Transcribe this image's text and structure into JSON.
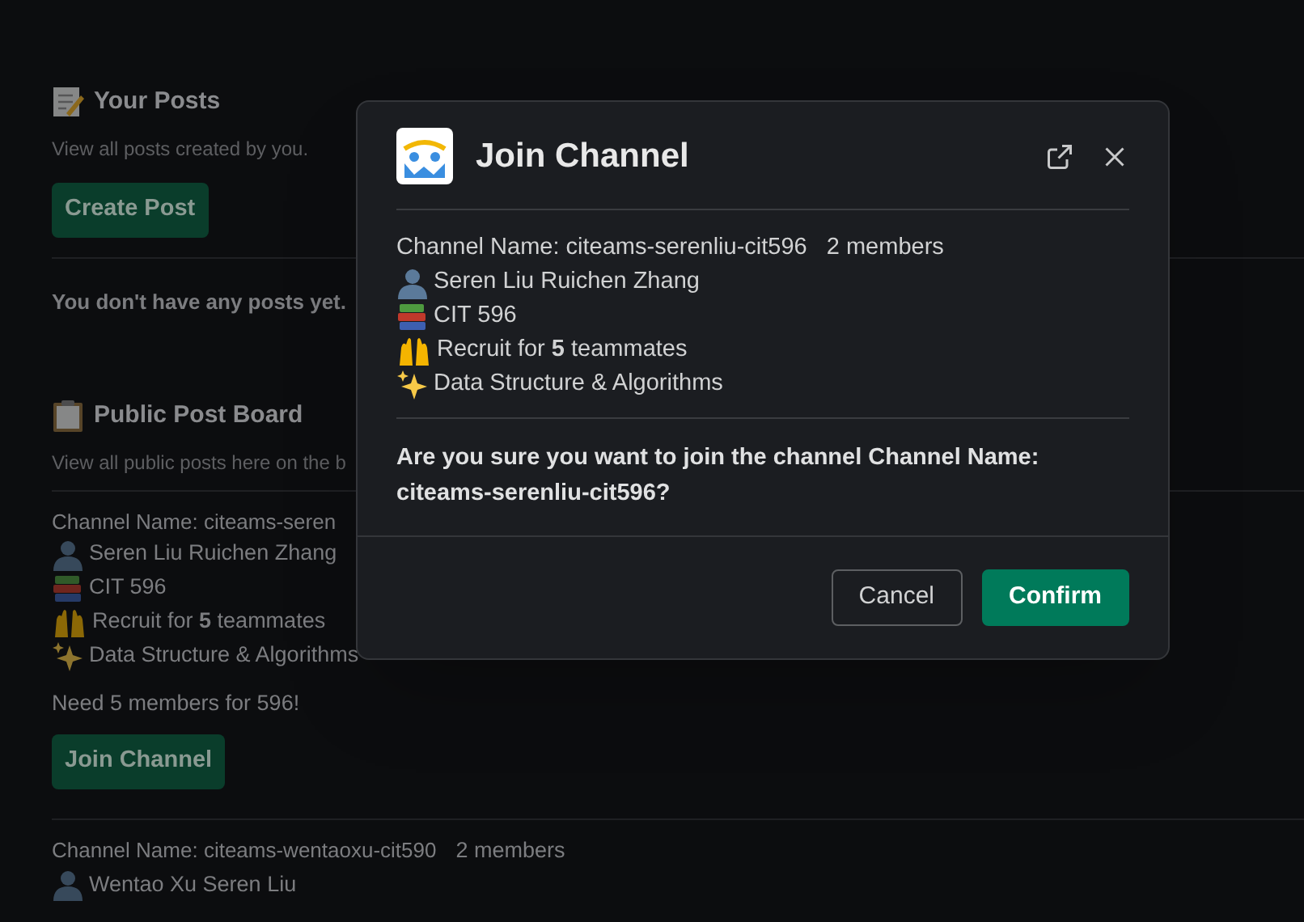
{
  "page": {
    "your_posts": {
      "title": "Your Posts",
      "subtitle": "View all posts created by you.",
      "button": "Create Post",
      "empty": "You don't have any posts yet."
    },
    "board": {
      "title": "Public Post Board",
      "subtitle": "View all public posts here on the b",
      "posts": [
        {
          "channel": "Channel Name: citeams-seren",
          "lines": [
            {
              "kind": "people",
              "text": "Seren Liu Ruichen Zhang"
            },
            {
              "kind": "course",
              "text": "CIT 596"
            },
            {
              "kind": "recruit",
              "text": "Recruit for **5** teammates"
            },
            {
              "kind": "topic",
              "text": "Data Structure & Algorithms"
            }
          ],
          "description": "Need 5 members for 596!",
          "button": "Join Channel"
        },
        {
          "channel": "Channel Name: citeams-wentaoxu-cit590",
          "members": "2 members",
          "lines": [
            {
              "kind": "people",
              "text": "Wentao Xu Seren Liu"
            }
          ]
        }
      ]
    }
  },
  "modal": {
    "title": "Join Channel",
    "channel": "Channel Name: citeams-serenliu-cit596",
    "members": "2 members",
    "lines": [
      {
        "kind": "people",
        "text": "Seren Liu Ruichen Zhang"
      },
      {
        "kind": "course",
        "text": "CIT 596"
      },
      {
        "kind": "recruit",
        "text": "Recruit for **5** teammates"
      },
      {
        "kind": "topic",
        "text": "Data Structure & Algorithms"
      }
    ],
    "question": "Are you sure you want to join the channel Channel Name: citeams-serenliu-cit596?",
    "buttons": [
      {
        "kind": "secondary",
        "label": "Cancel"
      },
      {
        "kind": "primary",
        "label": "Confirm"
      }
    ]
  }
}
